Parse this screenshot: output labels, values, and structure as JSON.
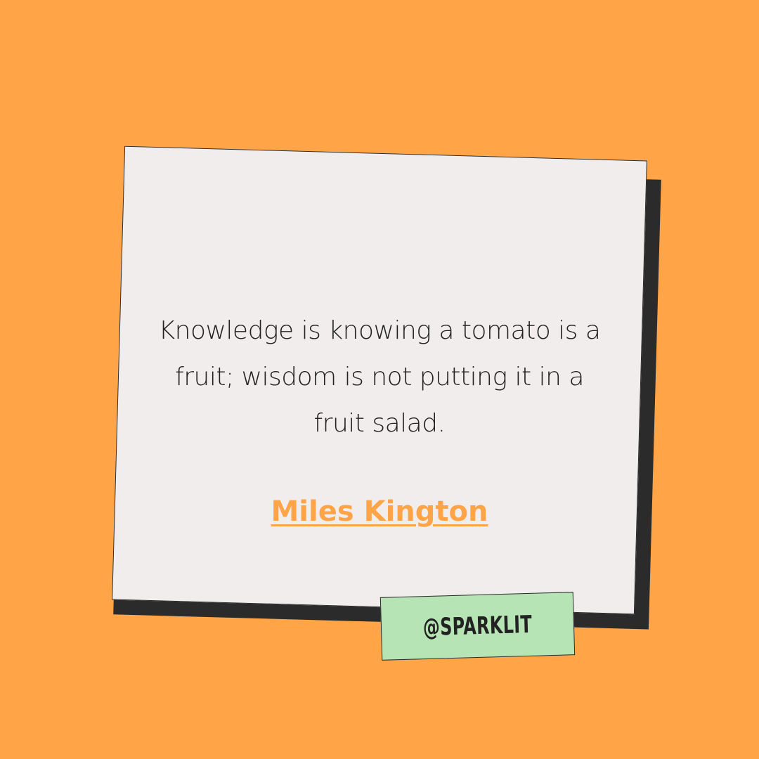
{
  "quote": {
    "text": "Knowledge is knowing a tomato is a fruit; wisdom is not putting it in a fruit salad."
  },
  "author": {
    "name": "Miles Kington"
  },
  "social": {
    "handle": "@SPARKLIT"
  },
  "colors": {
    "background": "#FFA547",
    "card": "#F0EDEC",
    "card_shadow": "#2B2B2B",
    "text": "#222222",
    "author_accent": "#FFA547",
    "tag": "#B7E4B4"
  }
}
